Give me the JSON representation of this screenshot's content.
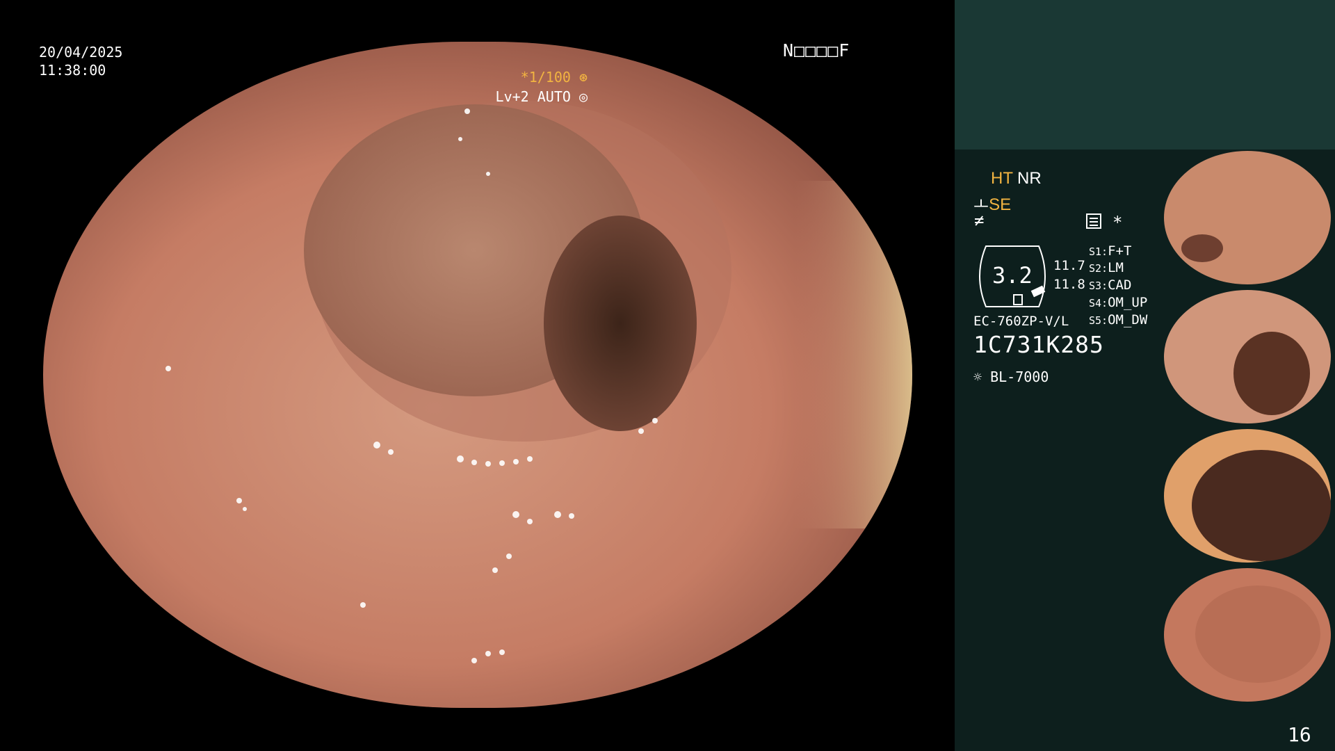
{
  "overlay": {
    "date": "20/04/2025",
    "time": "11:38:00",
    "code": "N□□□□F",
    "shutter": "*1/100",
    "level": "Lv+2 AUTO"
  },
  "panel": {
    "ht": "HT",
    "nr": "NR",
    "se": "SE",
    "wave": "≠",
    "value_1": "11.7",
    "value_2": "11.8",
    "gauge_value": "3.2",
    "scope_model": "EC-760ZP-V/L",
    "serial": "1C731K285",
    "light_source": "BL-7000",
    "settings": [
      {
        "key": "S1:",
        "value": "F+T"
      },
      {
        "key": "S2:",
        "value": "LM"
      },
      {
        "key": "S3:",
        "value": "CAD"
      },
      {
        "key": "S4:",
        "value": "OM_UP"
      },
      {
        "key": "S5:",
        "value": "OM_DW"
      }
    ],
    "star": "*"
  },
  "page_number": "16",
  "colors": {
    "accent": "#f2b441",
    "panel_bg": "#0d1f1d",
    "panel_top": "#1a3834",
    "mucosa": "#c9826c"
  },
  "icons": {
    "shutter": "aperture-icon",
    "level": "iris-icon",
    "se": "enhance-icon",
    "light": "lightbulb-icon",
    "menu": "memo-icon"
  }
}
